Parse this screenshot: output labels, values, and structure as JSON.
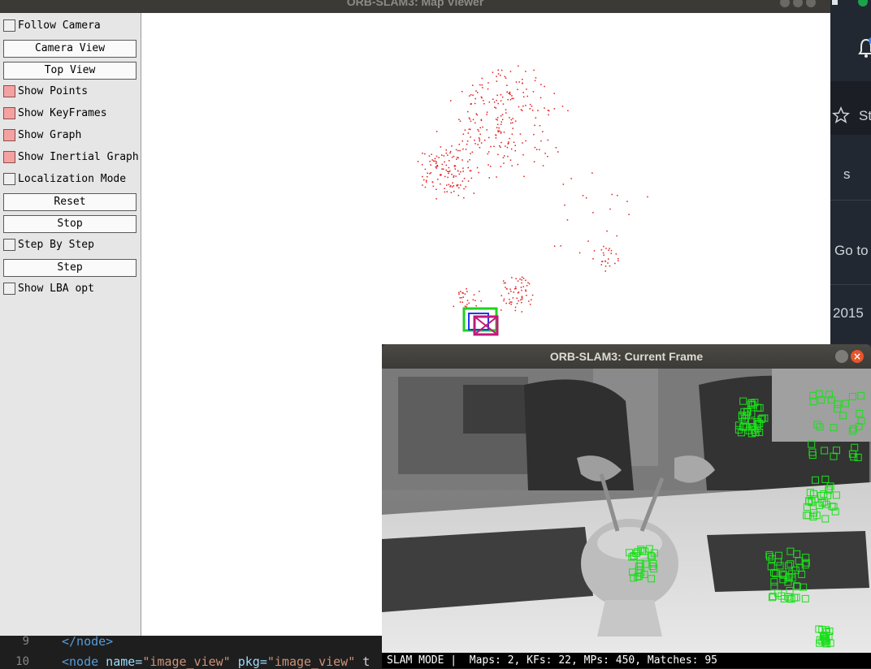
{
  "map_viewer": {
    "title": "ORB-SLAM3: Map Viewer",
    "controls": [
      {
        "type": "checkbox",
        "label": "Follow Camera",
        "checked": false
      },
      {
        "type": "button",
        "label": "Camera View"
      },
      {
        "type": "button",
        "label": "Top View"
      },
      {
        "type": "checkbox",
        "label": "Show Points",
        "checked": true
      },
      {
        "type": "checkbox",
        "label": "Show KeyFrames",
        "checked": true
      },
      {
        "type": "checkbox",
        "label": "Show Graph",
        "checked": true
      },
      {
        "type": "checkbox",
        "label": "Show Inertial Graph",
        "checked": true
      },
      {
        "type": "checkbox",
        "label": "Localization Mode",
        "checked": false
      },
      {
        "type": "button",
        "label": "Reset"
      },
      {
        "type": "button",
        "label": "Stop"
      },
      {
        "type": "checkbox",
        "label": "Step By Step",
        "checked": false
      },
      {
        "type": "button",
        "label": "Step"
      },
      {
        "type": "checkbox",
        "label": "Show LBA opt",
        "checked": false
      }
    ],
    "point_color": "#e31a1a",
    "keyframe_color": "#1fd21f",
    "checked_color": "#f4a1a1"
  },
  "current_frame": {
    "title": "ORB-SLAM3: Current Frame",
    "status_text": "SLAM MODE |  Maps: 2, KFs: 22, MPs: 450, Matches: 95",
    "feature_color": "#19e019"
  },
  "background": {
    "partial_texts": [
      "St",
      "s",
      "Go to",
      "2015"
    ],
    "editor_lines": [
      {
        "number": "9",
        "code": "</node>"
      },
      {
        "number": "10",
        "tag_open": "<node",
        "attr1": " name=",
        "val1": "\"image_view\"",
        "attr2": " pkg=",
        "val2": "\"image_view\"",
        "tail": " t"
      }
    ]
  }
}
